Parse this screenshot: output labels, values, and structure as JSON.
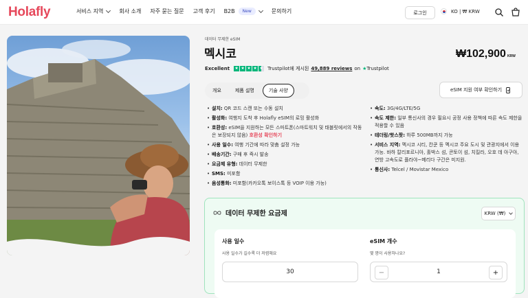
{
  "header": {
    "logo": "Holafly",
    "nav": [
      {
        "label": "서비스 지역",
        "dropdown": true
      },
      {
        "label": "회사 소개",
        "dropdown": false
      },
      {
        "label": "자주 묻는 질문",
        "dropdown": false
      },
      {
        "label": "고객 후기",
        "dropdown": false
      },
      {
        "label": "B2B",
        "badge": "New",
        "dropdown": true
      },
      {
        "label": "문의하기",
        "dropdown": false
      }
    ],
    "login": "로그인",
    "lang_currency": "KO | ₩ KRW",
    "icons": [
      "search-icon",
      "cart-icon"
    ]
  },
  "product": {
    "eyebrow": "데이터 무제한 eSIM",
    "title": "멕시코",
    "price": "₩102,900",
    "price_currency": "KRW",
    "rating_label": "Excellent",
    "rating_prefix": "Trustpilot에 게시된",
    "reviews": "49,889 reviews",
    "rating_suffix": "on",
    "trustpilot": "Trustpilot",
    "tabs": [
      {
        "label": "개요",
        "active": false
      },
      {
        "label": "제품 설명",
        "active": false
      },
      {
        "label": "기술 사양",
        "active": true
      }
    ],
    "compat_button": "eSIM 지원 여부 확인하기"
  },
  "specs_left": [
    {
      "key": "설치:",
      "value": "QR 코드 스캔 또는 수동 설치"
    },
    {
      "key": "활성화:",
      "value": "여행지 도착 후 Holafly eSIM의 로밍 활성화"
    },
    {
      "key": "호환성:",
      "value": "eSIM을 지원하는 모든 스마트폰(스마트워치 및 태블릿에서의 작동은 보장되지 않음)",
      "link": "호환성 확인하기"
    },
    {
      "key": "사용 일수:",
      "value": "여행 기간에 따라 맞춤 설정 가능"
    },
    {
      "key": "배송기간:",
      "value": "구매 후 즉시 발송"
    },
    {
      "key": "요금제 유형:",
      "value": "데이터 무제한"
    },
    {
      "key": "SMS:",
      "value": "미포함"
    },
    {
      "key": "음성통화:",
      "value": "미포함(카카오톡 보이스톡 등 VOIP 이용 가능)"
    }
  ],
  "specs_right": [
    {
      "key": "속도:",
      "value": "3G/4G/LTE/5G"
    },
    {
      "key": "속도 제한:",
      "value": "일부 통신사의 경우 필요시 공정 사용 정책에 따른 속도 제한을 적용할 수 있음"
    },
    {
      "key": "테더링/핫스팟:",
      "value": "하루 500MB까지 가능"
    },
    {
      "key": "서비스 지역:",
      "value": "멕시코 시티, 칸쿤 등 멕시코 주요 도시 및 관광지에서 이용 가능. 바하 칼리포르니아, 홀박스 섬, 콘토이 섬, 치킬라, 오호 데 아구아, 연방 고속도로 플라야~메리다 구간은 미지원."
    },
    {
      "key": "통신사:",
      "value": "Telcel / Movistar Mexico"
    }
  ],
  "plan": {
    "title": "데이터 무제한 요금제",
    "currency": "KRW (₩)",
    "days_label": "사용 일수",
    "days_hint": "사용 일수가 길수록 더 저렴해요",
    "days_value": "30",
    "esim_label": "eSIM 개수",
    "esim_hint": "몇 명이 사용하나요?",
    "esim_value": "1",
    "minus": "−",
    "plus": "+"
  }
}
